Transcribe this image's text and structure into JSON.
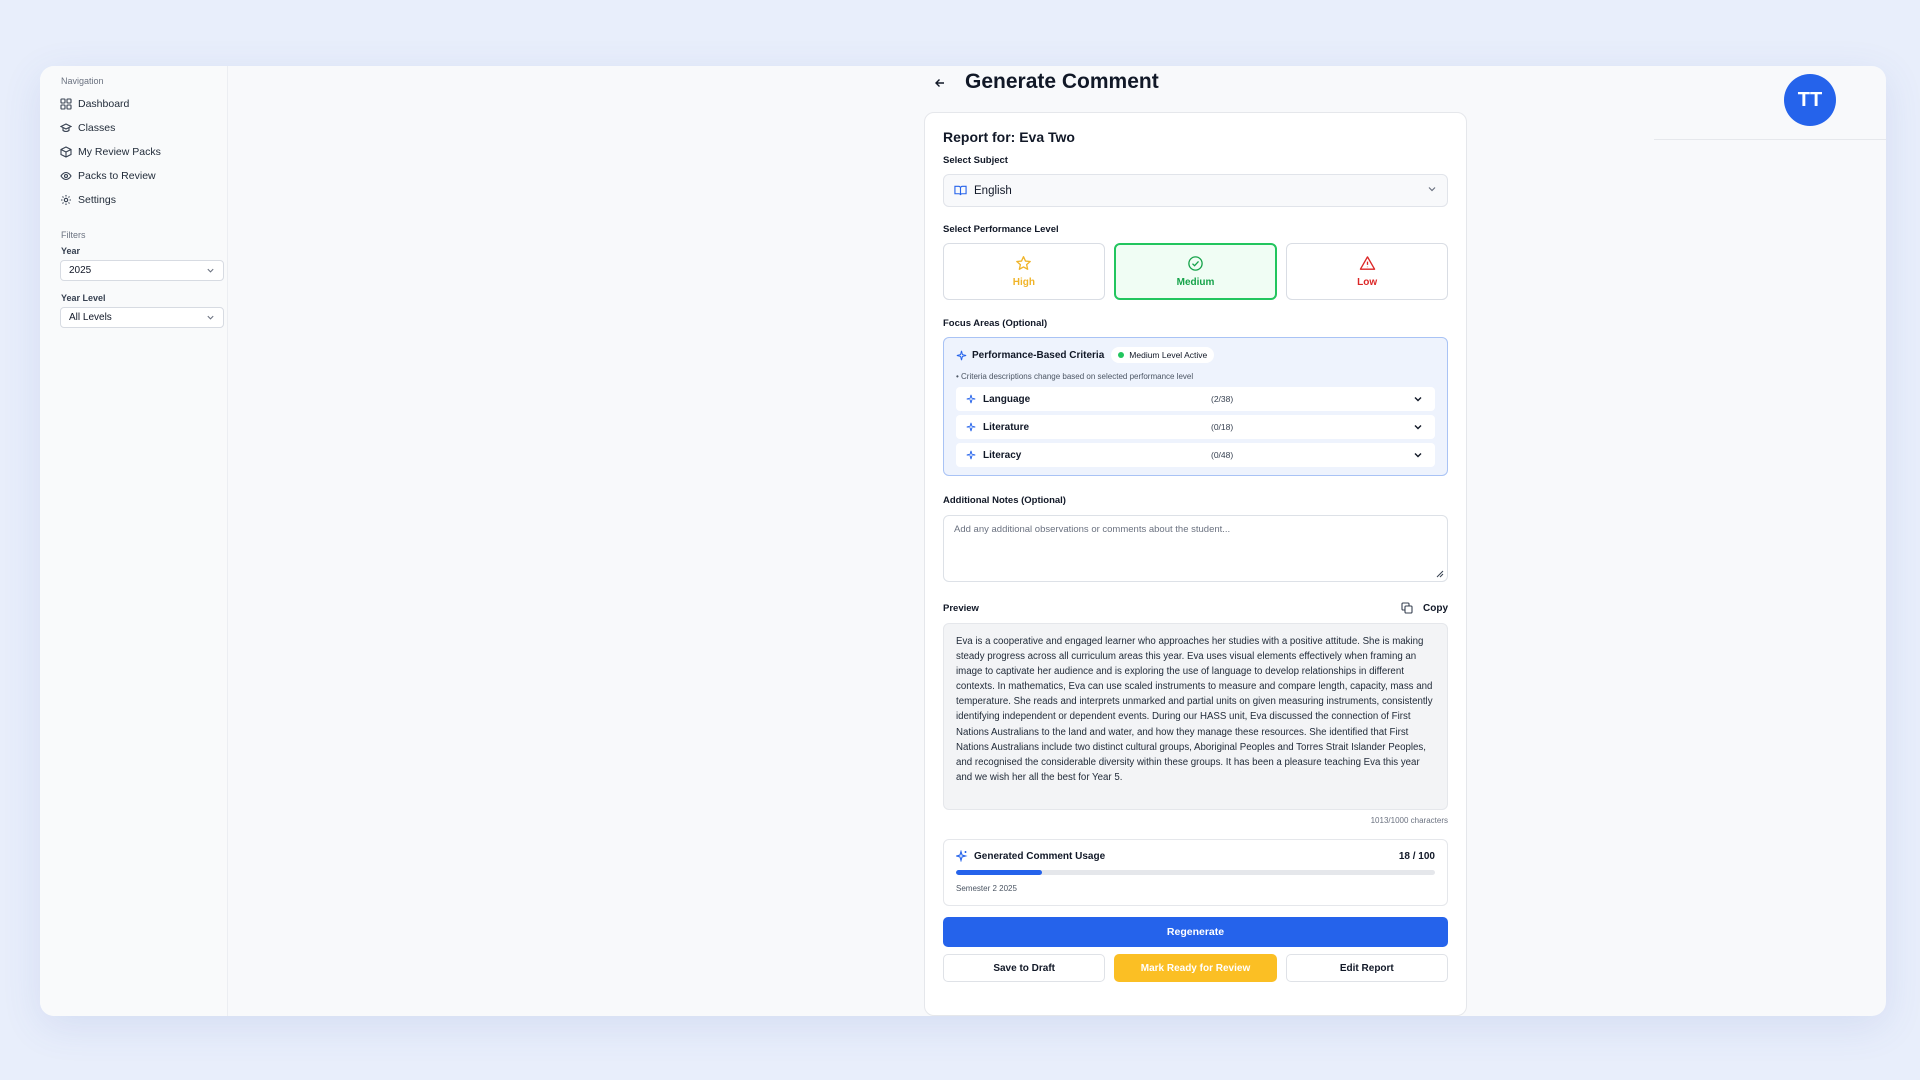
{
  "sidebar": {
    "nav_title": "Navigation",
    "items": [
      {
        "label": "Dashboard"
      },
      {
        "label": "Classes"
      },
      {
        "label": "My Review Packs"
      },
      {
        "label": "Packs to Review"
      },
      {
        "label": "Settings"
      }
    ],
    "filters_title": "Filters",
    "year_label": "Year",
    "year_value": "2025",
    "year_level_label": "Year Level",
    "year_level_value": "All Levels"
  },
  "header": {
    "avatar_initials": "TT"
  },
  "page": {
    "title": "Generate Comment"
  },
  "report": {
    "report_for": "Report for: Eva Two",
    "subject_label": "Select Subject",
    "subject_value": "English",
    "performance_label": "Select Performance Level",
    "levels": [
      {
        "label": "High",
        "icon": "star-icon",
        "color": "#f0b429"
      },
      {
        "label": "Medium",
        "icon": "check-circle-icon",
        "color": "#16a34a",
        "selected": true
      },
      {
        "label": "Low",
        "icon": "warning-triangle-icon",
        "color": "#dc2626"
      }
    ],
    "focus_label": "Focus Areas (Optional)",
    "criteria_title": "Performance-Based Criteria",
    "criteria_badge": "Medium Level Active",
    "criteria_note": "• Criteria descriptions change based on selected performance level",
    "criteria": [
      {
        "name": "Language",
        "count": "(2/38)"
      },
      {
        "name": "Literature",
        "count": "(0/18)"
      },
      {
        "name": "Literacy",
        "count": "(0/48)"
      }
    ],
    "notes_label": "Additional Notes (Optional)",
    "notes_placeholder": "Add any additional observations or comments about the student...",
    "preview_label": "Preview",
    "copy_label": "Copy",
    "preview_text": "Eva is a cooperative and engaged learner who approaches her studies with a positive attitude. She is making steady progress across all curriculum areas this year. Eva uses visual elements effectively when framing an image to captivate her audience and is exploring the use of language to develop relationships in different contexts. In mathematics, Eva can use scaled instruments to measure and compare length, capacity, mass and temperature. She reads and interprets unmarked and partial units on given measuring instruments, consistently identifying independent or dependent events. During our HASS unit, Eva discussed the connection of First Nations Australians to the land and water, and how they manage these resources. She identified that First Nations Australians include two distinct cultural groups, Aboriginal Peoples and Torres Strait Islander Peoples, and recognised the considerable diversity within these groups. It has been a pleasure teaching Eva this year and we wish her all the best for Year 5.",
    "char_count": "1013/1000 characters",
    "usage_label": "Generated Comment Usage",
    "usage_value": "18 / 100",
    "usage_fraction": 0.18,
    "usage_semester": "Semester 2 2025",
    "regenerate_label": "Regenerate",
    "save_draft_label": "Save to Draft",
    "mark_ready_label": "Mark Ready for Review",
    "edit_report_label": "Edit Report"
  },
  "colors": {
    "accent": "#2563eb",
    "medium": "#22c55e",
    "ready": "#fbbf24"
  }
}
